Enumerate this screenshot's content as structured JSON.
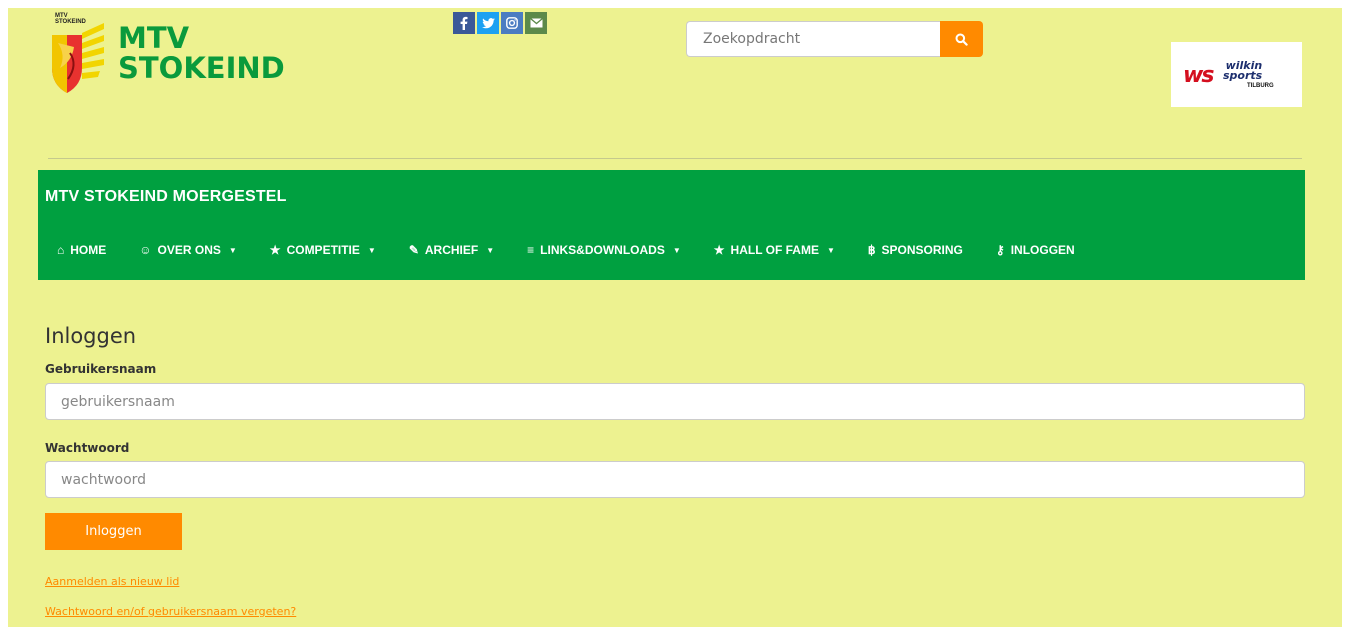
{
  "header": {
    "logo_line1": "MTV",
    "logo_line2": "STOKEIND",
    "crest_line1": "MTV",
    "crest_line2": "STOKEIND",
    "social": {
      "facebook": "f",
      "twitter": "t",
      "instagram": "ig",
      "email": "mail"
    },
    "search_placeholder": "Zoekopdracht",
    "sponsor": {
      "initials": "ws",
      "line1": "wilkin",
      "line2": "sports",
      "city": "TILBURG"
    }
  },
  "navbar": {
    "brand": "MTV STOKEIND MOERGESTEL",
    "items": [
      {
        "icon": "⌂",
        "label": "HOME",
        "caret": ""
      },
      {
        "icon": "☺",
        "label": "OVER ONS",
        "caret": "▼"
      },
      {
        "icon": "★",
        "label": "COMPETITIE",
        "caret": "▼"
      },
      {
        "icon": "✎",
        "label": "ARCHIEF",
        "caret": "▼"
      },
      {
        "icon": "≡",
        "label": "LINKS&DOWNLOADS",
        "caret": "▼"
      },
      {
        "icon": "★",
        "label": "HALL OF FAME",
        "caret": "▼"
      },
      {
        "icon": "฿",
        "label": "SPONSORING",
        "caret": ""
      },
      {
        "icon": "⚷",
        "label": "INLOGGEN",
        "caret": ""
      }
    ]
  },
  "login": {
    "title": "Inloggen",
    "username_label": "Gebruikersnaam",
    "username_placeholder": "gebruikersnaam",
    "password_label": "Wachtwoord",
    "password_placeholder": "wachtwoord",
    "submit_label": "Inloggen",
    "register_link": "Aanmelden als nieuw lid",
    "forgot_link": "Wachtwoord en/of gebruikersnaam vergeten?"
  },
  "colors": {
    "page_bg": "#edf290",
    "nav_green": "#00a040",
    "accent_orange": "#ff8a00",
    "logo_green": "#0a9a3c"
  }
}
